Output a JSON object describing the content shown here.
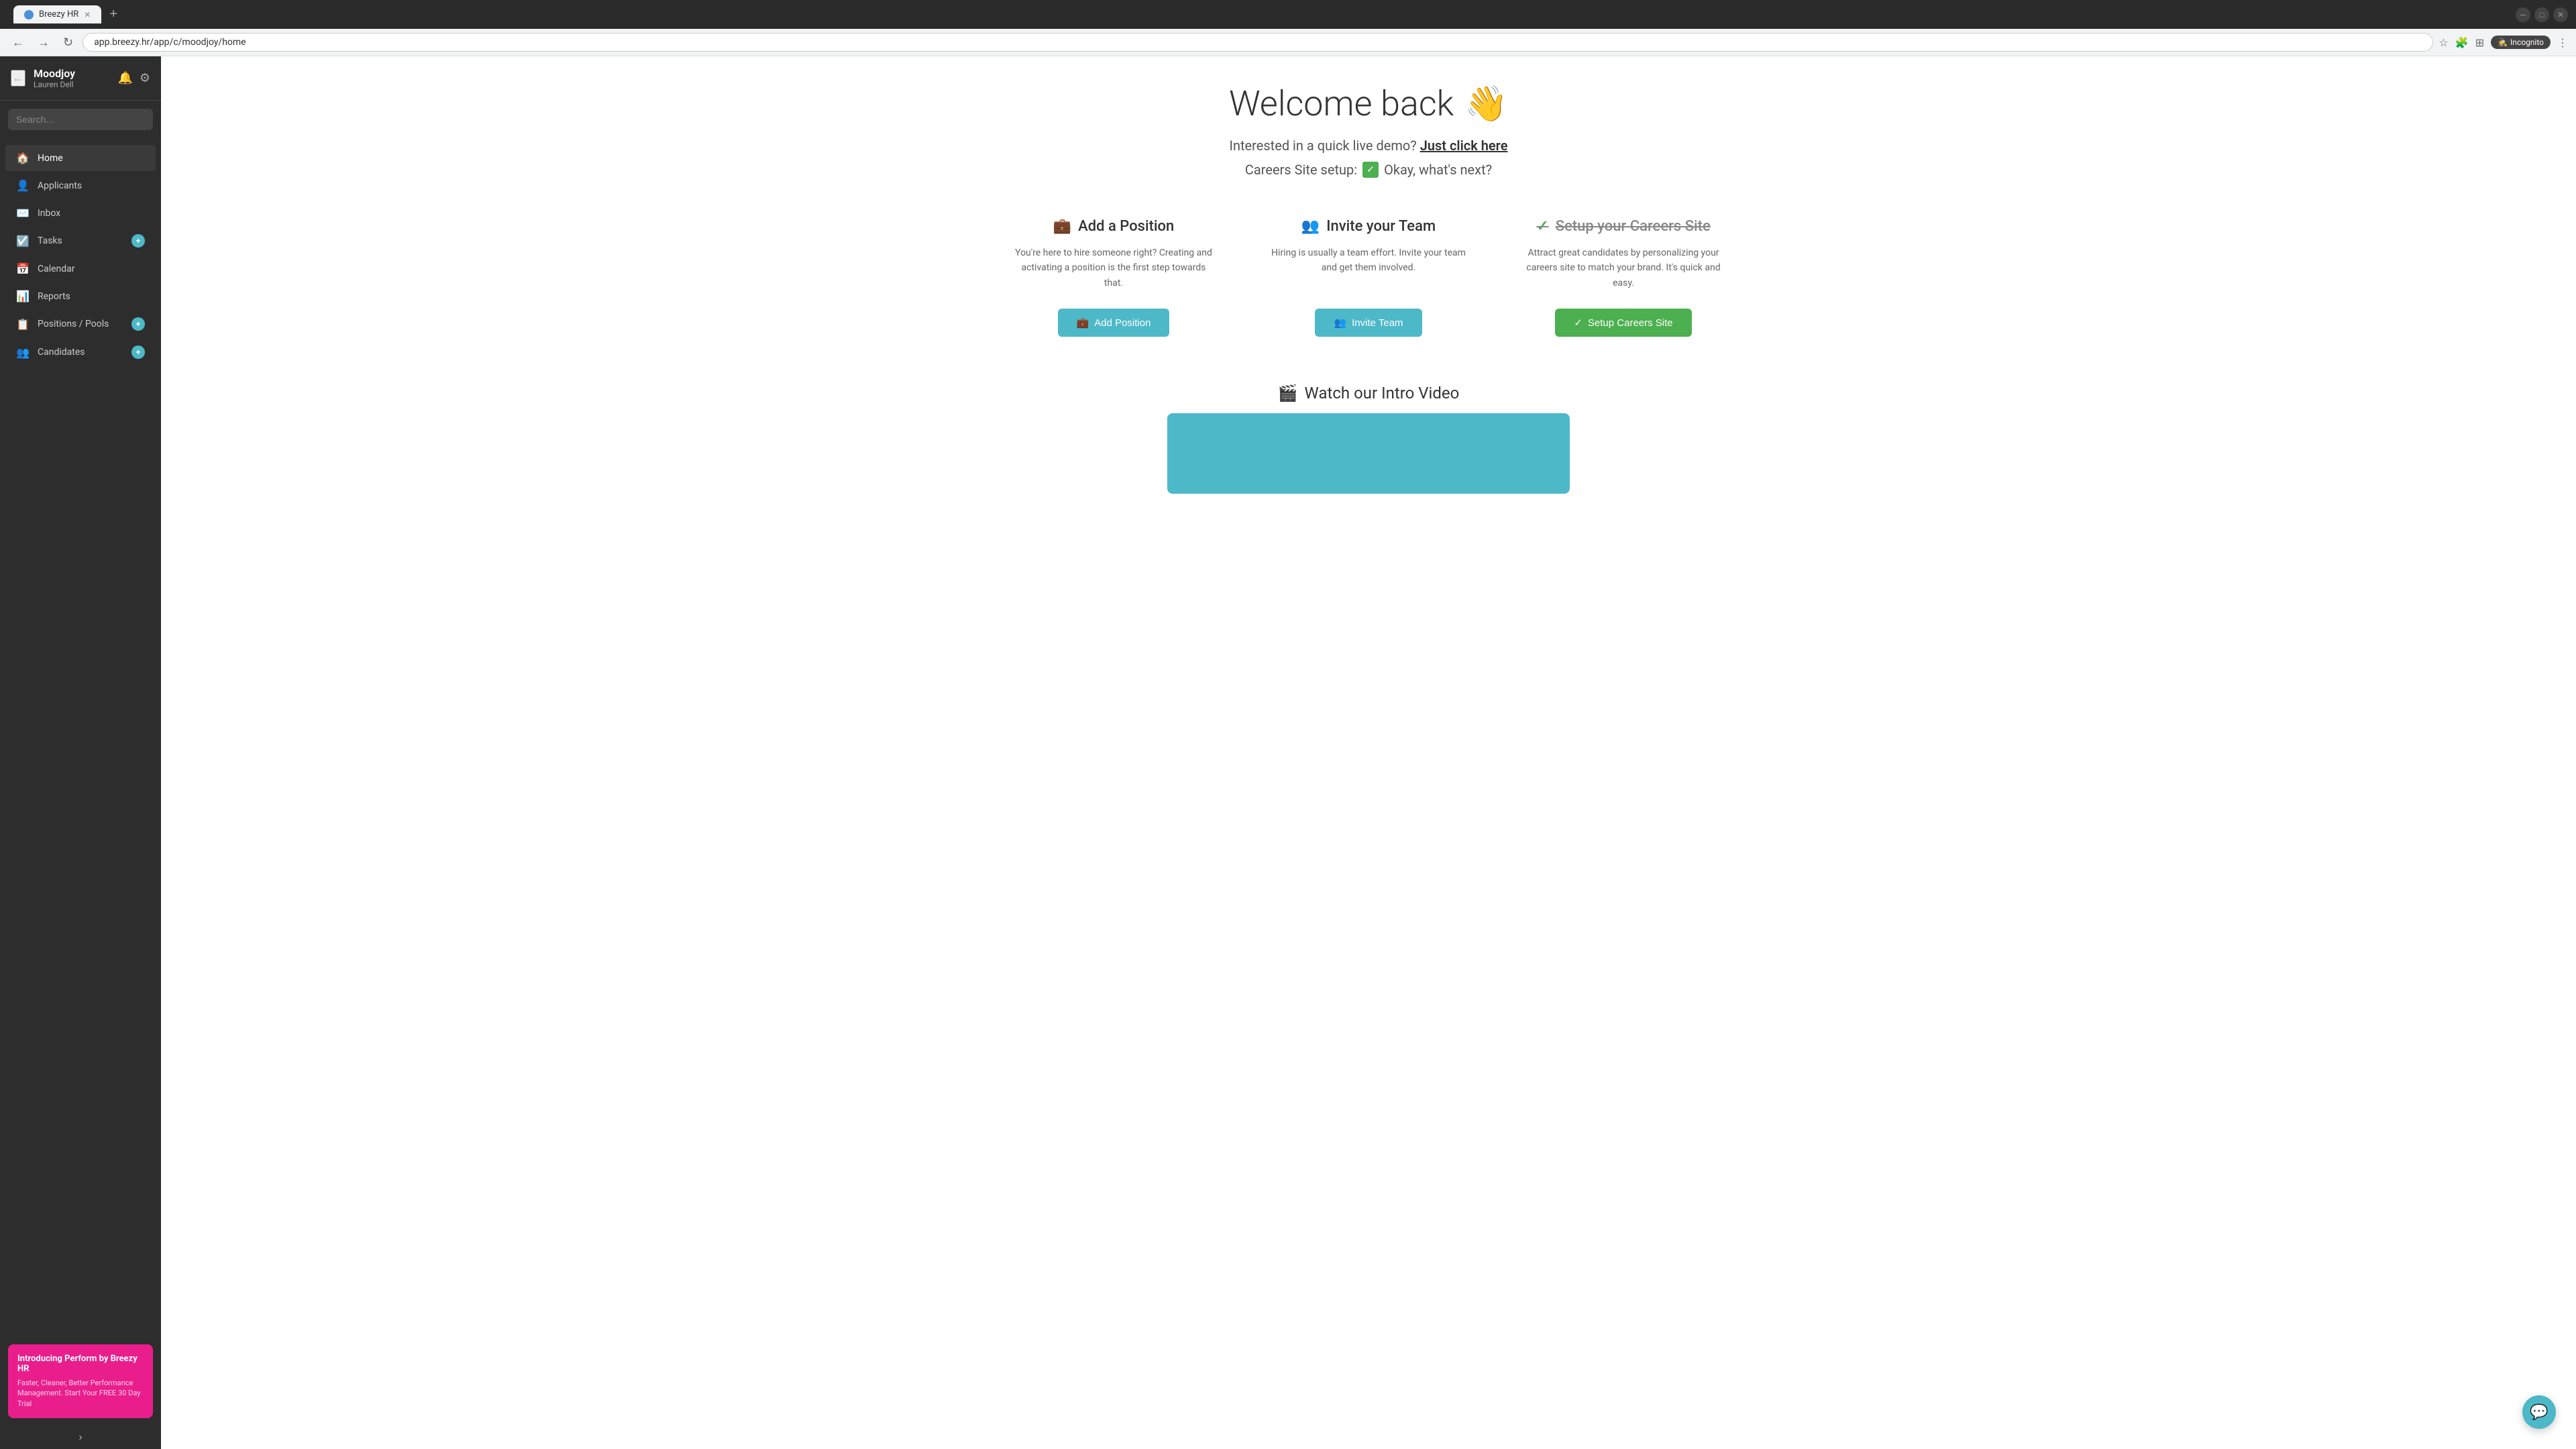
{
  "browser": {
    "tab_label": "Breezy HR",
    "url": "app.breezy.hr/app/c/moodjoy/home",
    "incognito_label": "Incognito"
  },
  "sidebar": {
    "back_arrow": "←",
    "brand_name": "Moodjoy",
    "brand_user": "Lauren Dell",
    "search_placeholder": "Search...",
    "nav_items": [
      {
        "id": "home",
        "label": "Home",
        "icon": "🏠",
        "badge": null
      },
      {
        "id": "applicants",
        "label": "Applicants",
        "icon": "👤",
        "badge": null
      },
      {
        "id": "inbox",
        "label": "Inbox",
        "icon": "✉️",
        "badge": null
      },
      {
        "id": "tasks",
        "label": "Tasks",
        "icon": "☑️",
        "badge": "+"
      },
      {
        "id": "calendar",
        "label": "Calendar",
        "icon": "📅",
        "badge": null
      },
      {
        "id": "reports",
        "label": "Reports",
        "icon": "📊",
        "badge": null
      },
      {
        "id": "positions",
        "label": "Positions / Pools",
        "icon": "📋",
        "badge": "+"
      },
      {
        "id": "candidates",
        "label": "Candidates",
        "icon": "👥",
        "badge": "+"
      }
    ],
    "promo": {
      "title": "Introducing Perform by Breezy HR",
      "desc": "Faster, Cleaner, Better Performance Management. Start Your FREE 30 Day Trial"
    }
  },
  "main": {
    "welcome_title": "Welcome back",
    "wave_emoji": "👋",
    "demo_line": "Interested in a quick live demo?",
    "demo_link_text": "Just click here",
    "careers_line": "Careers Site setup:",
    "careers_status": "Okay, what's next?",
    "cards": [
      {
        "id": "add-position",
        "icon": "💼",
        "title": "Add a Position",
        "strikethrough": false,
        "desc": "You're here to hire someone right? Creating and activating a position is the first step towards that.",
        "btn_label": "Add Position",
        "btn_icon": "💼"
      },
      {
        "id": "invite-team",
        "icon": "👥",
        "title": "Invite your Team",
        "strikethrough": false,
        "desc": "Hiring is usually a team effort. Invite your team and get them involved.",
        "btn_label": "Invite Team",
        "btn_icon": "👥"
      },
      {
        "id": "setup-careers",
        "icon": "✓",
        "title": "Setup your Careers Site",
        "strikethrough": true,
        "desc": "Attract great candidates by personalizing your careers site to match your brand. It's quick and easy.",
        "btn_label": "Setup Careers Site",
        "btn_icon": "✓"
      }
    ],
    "video_title": "Watch our Intro Video",
    "video_icon": "🎬"
  },
  "chat_btn_icon": "💬"
}
